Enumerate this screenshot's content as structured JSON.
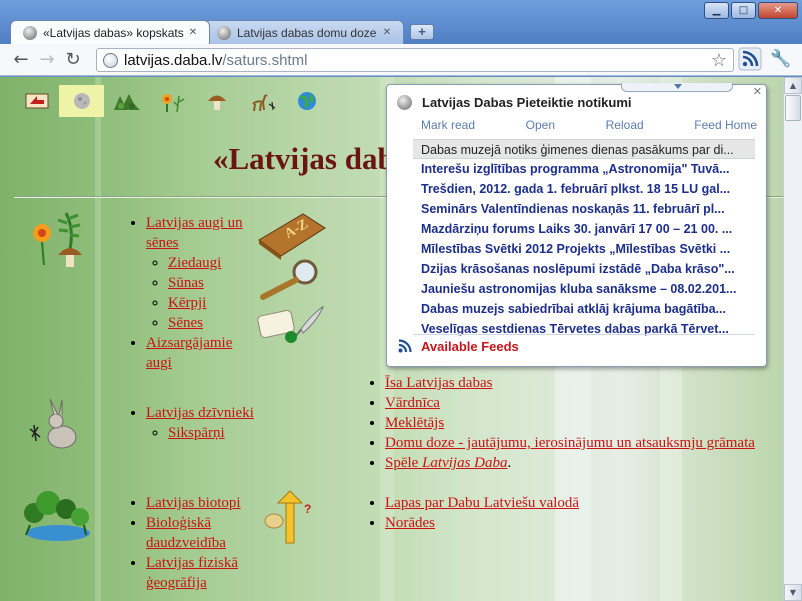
{
  "window": {
    "minimize": "▁",
    "maximize": "□",
    "close": "✕"
  },
  "tabs": [
    {
      "title": "«Latvijas dabas» kopskats",
      "close": "✕"
    },
    {
      "title": "Latvijas dabas domu doze",
      "close": "✕"
    }
  ],
  "newtab": "+",
  "toolbar": {
    "back": "←",
    "forward": "→",
    "reload": "↻",
    "url_host": "latvijas.daba.lv",
    "url_path": "/saturs.shtml",
    "star": "☆",
    "wrench": "🔧"
  },
  "page": {
    "title": "«Latvijas dabas",
    "nav_icons": [
      "back-icon",
      "moon-icon",
      "landscape-icon",
      "flowers-icon",
      "mushroom-icon",
      "deer-icon",
      "globe-icon"
    ],
    "col_a1": {
      "items": [
        {
          "label": "Latvijas augi un sēnes",
          "sub": [
            "Ziedaugi",
            "Sūnas",
            "Kērpji",
            "Sēnes"
          ]
        },
        {
          "label": "Aizsargājamie augi",
          "sub": []
        }
      ]
    },
    "col_a2": {
      "items": [
        {
          "label": "Latvijas dzīvnieki",
          "sub": [
            "Sikspārņi"
          ]
        }
      ]
    },
    "col_a3": {
      "items": [
        {
          "label": "Latvijas biotopi"
        },
        {
          "label": "Bioloģiskā daudzveidība"
        },
        {
          "label": "Latvijas fiziskā ģeogrāfija"
        }
      ]
    },
    "col_b1": {
      "partial": "Īsa Latvijas dabas",
      "items": [
        "Vārdnīca",
        "Meklētājs",
        "Domu doze - jautājumu, ierosinājumu un atsauksmju grāmata"
      ],
      "game_prefix": "Spēle ",
      "game_name": "Latvijas Daba",
      "game_suffix": "."
    },
    "col_b3": {
      "items": [
        "Lapas par Dabu Latviešu valodā",
        "Norādes"
      ]
    }
  },
  "popup": {
    "title": "Latvijas Dabas Pieteiktie notikumi",
    "close": "✕",
    "actions": [
      "Mark read",
      "Open",
      "Reload",
      "Feed Home"
    ],
    "items": [
      "Dabas muzejā notiks ģimenes dienas pasākums par di...",
      "Interešu izglītības programma „Astronomija\" Tuvā...",
      "Trešdien, 2012. gada 1. februārī plkst. 18 15 LU gal...",
      "Seminārs Valentīndienas noskaņās 11. februārī pl...",
      "Mazdārziņu forums Laiks 30. janvārī 17 00 – 21 00. ...",
      "Mīlestības Svētki 2012 Projekts „Mīlestības Svētki ...",
      "Dzijas krāsošanas noslēpumi izstādē „Daba krāso\"...",
      "Jauniešu astronomijas kluba sanāksme – 08.02.201...",
      "Dabas muzejs sabiedrībai atklāj krājuma bagātība...",
      "Veselīgas sestdienas Tērvetes dabas parkā Tērvet..."
    ],
    "available_feeds": "Available Feeds"
  },
  "scroll": {
    "up": "▲",
    "down": "▼"
  },
  "colors": {
    "link": "#cc1111",
    "title": "#6b1414",
    "feed_item": "#1d2f8c",
    "available_feeds": "#c4161c",
    "rss": "#1f4f8f"
  }
}
